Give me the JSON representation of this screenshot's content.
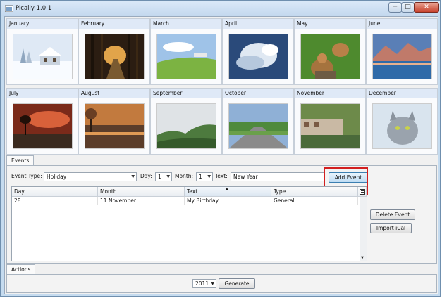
{
  "window": {
    "title": "Pically 1.0.1",
    "minimize": "─",
    "maximize": "□",
    "close": "✕"
  },
  "months": [
    {
      "name": "January",
      "scene": "snow-house"
    },
    {
      "name": "February",
      "scene": "forest-path"
    },
    {
      "name": "March",
      "scene": "green-hills"
    },
    {
      "name": "April",
      "scene": "cloudy-sky"
    },
    {
      "name": "May",
      "scene": "squirrels"
    },
    {
      "name": "June",
      "scene": "mountain-lake"
    },
    {
      "name": "July",
      "scene": "red-sunset"
    },
    {
      "name": "August",
      "scene": "autumn-lake"
    },
    {
      "name": "September",
      "scene": "misty-valley"
    },
    {
      "name": "October",
      "scene": "country-road"
    },
    {
      "name": "November",
      "scene": "seaside-town"
    },
    {
      "name": "December",
      "scene": "grey-cat"
    }
  ],
  "events_tab": {
    "label": "Events"
  },
  "form": {
    "event_type_label": "Event Type:",
    "event_type_value": "Holiday",
    "day_label": "Day:",
    "day_value": "1",
    "month_label": "Month:",
    "month_value": "1",
    "text_label": "Text:",
    "text_value": "New Year",
    "add_event": "Add Event"
  },
  "table": {
    "columns": [
      "Day",
      "Month",
      "Text",
      "Type"
    ],
    "rows": [
      [
        "28",
        "11 November",
        "My Birthday",
        "General"
      ]
    ]
  },
  "side_buttons": {
    "delete_event": "Delete Event",
    "import_ical": "Import iCal"
  },
  "actions_tab": {
    "label": "Actions"
  },
  "actions": {
    "year_value": "2011",
    "generate": "Generate"
  },
  "icons": {
    "dropdown": "▼",
    "sort": "▲"
  }
}
